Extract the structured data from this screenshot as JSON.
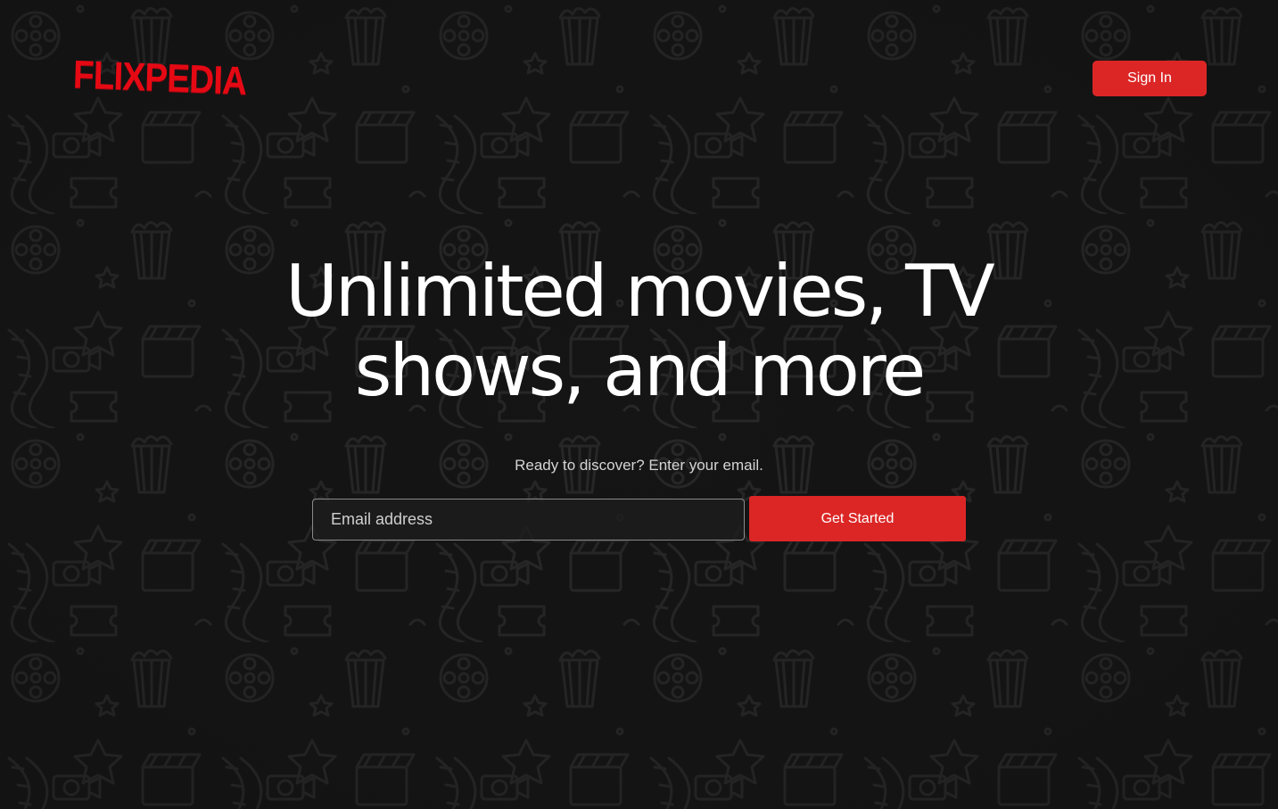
{
  "brand": {
    "logo_text": "FLIXPEDIA",
    "accent_color": "#dc2626"
  },
  "header": {
    "sign_in_label": "Sign In"
  },
  "hero": {
    "title_line1": "Unlimited movies, TV",
    "title_line2": "shows, and more",
    "subtitle": "Ready to discover? Enter your email."
  },
  "signup_form": {
    "email_placeholder": "Email address",
    "email_value": "",
    "submit_label": "Get Started"
  },
  "background": {
    "pattern": "cinema-doodle-pattern"
  }
}
